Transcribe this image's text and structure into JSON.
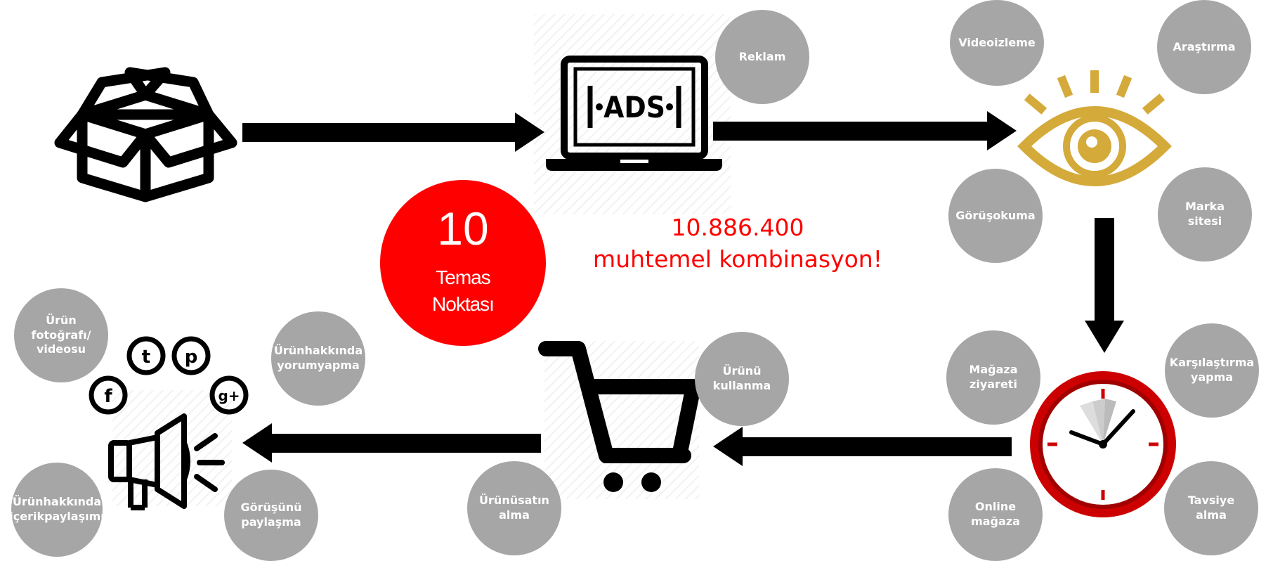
{
  "center": {
    "count": "10",
    "count_label": "Temas\nNoktası",
    "combinations_value": "10.886.400",
    "combinations_label": "muhtemel kombinasyon!"
  },
  "icons": {
    "box": "open-box-icon",
    "laptop": "laptop-ads-icon",
    "laptop_text": "ADS",
    "eye": "eye-icon",
    "clock": "clock-icon",
    "cart": "shopping-cart-icon",
    "megaphone": "megaphone-social-icon",
    "social": [
      "f",
      "t",
      "p",
      "g+"
    ]
  },
  "touchpoints": {
    "reklam": "Reklam",
    "video": "Videoizleme",
    "arastirma": "Araştırma",
    "gorus_okuma": "Görüşokuma",
    "marka_sitesi": "Marka\nsitesi",
    "magaza_ziyareti": "Mağaza\nziyareti",
    "karsilastirma": "Karşılaştırma\nyapma",
    "online_magaza": "Online\nmağaza",
    "tavsiye": "Tavsiye\nalma",
    "urunu_kullanma": "Ürünü\nkullanma",
    "satin_alma": "Ürünüsatın\nalma",
    "urun_foto": "Ürün\nfotoğrafı/\nvideosu",
    "yorum_yapma": "Ürünhakkında\nyorumyapma",
    "icerik_paylasimi": "Ürünhakkında\niçerikpaylaşımı",
    "gorusunu_paylasma": "Görüşünü\npaylaşma"
  },
  "colors": {
    "accent_red": "#ff0000",
    "circle_gray": "#a6a6a6",
    "eye_gold": "#d4aa3a",
    "clock_red": "#cc0000",
    "ink": "#000000"
  }
}
